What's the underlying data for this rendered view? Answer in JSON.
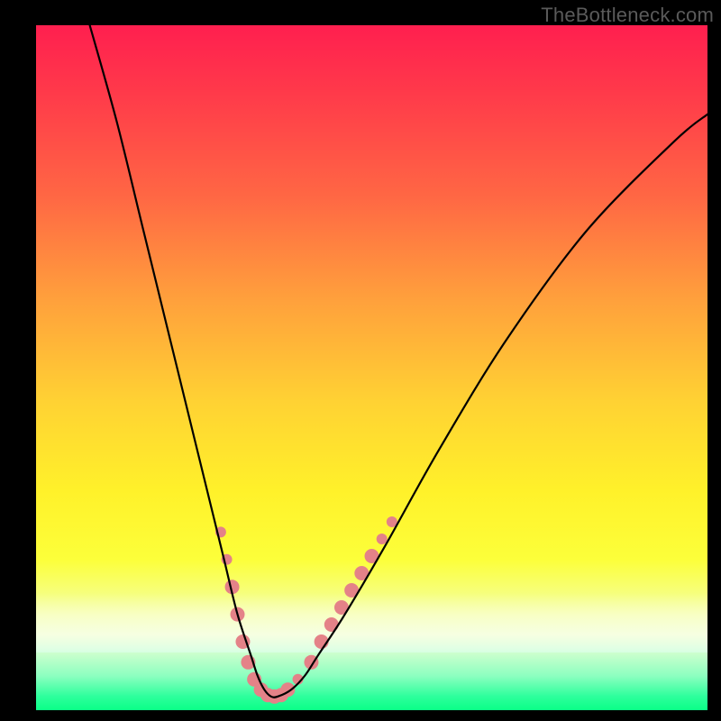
{
  "watermark": "TheBottleneck.com",
  "chart_data": {
    "type": "line",
    "title": "",
    "xlabel": "",
    "ylabel": "",
    "xlim": [
      0,
      100
    ],
    "ylim": [
      0,
      100
    ],
    "series": [
      {
        "name": "bottleneck-curve",
        "color": "#000000",
        "x": [
          8,
          12,
          16,
          20,
          24,
          26,
          28,
          30,
          32,
          33,
          34,
          35,
          36,
          38,
          40,
          42,
          46,
          52,
          60,
          70,
          82,
          95,
          100
        ],
        "y": [
          100,
          86,
          70,
          54,
          38,
          30,
          22,
          14,
          8,
          5,
          3,
          2,
          2,
          3,
          5,
          8,
          14,
          24,
          38,
          54,
          70,
          83,
          87
        ]
      }
    ],
    "markers": {
      "name": "highlight-points",
      "color": "#e48288",
      "radius_small": 5,
      "radius_large": 9,
      "points": [
        {
          "x": 27.5,
          "y": 26,
          "r": 6
        },
        {
          "x": 28.4,
          "y": 22,
          "r": 6
        },
        {
          "x": 29.2,
          "y": 18,
          "r": 8
        },
        {
          "x": 30.0,
          "y": 14,
          "r": 8
        },
        {
          "x": 30.8,
          "y": 10,
          "r": 8
        },
        {
          "x": 31.6,
          "y": 7,
          "r": 8
        },
        {
          "x": 32.5,
          "y": 4.5,
          "r": 8
        },
        {
          "x": 33.5,
          "y": 3,
          "r": 8
        },
        {
          "x": 34.5,
          "y": 2.2,
          "r": 8
        },
        {
          "x": 35.5,
          "y": 2,
          "r": 8
        },
        {
          "x": 36.5,
          "y": 2.2,
          "r": 8
        },
        {
          "x": 37.5,
          "y": 3,
          "r": 8
        },
        {
          "x": 39.0,
          "y": 4.5,
          "r": 6
        },
        {
          "x": 41.0,
          "y": 7,
          "r": 8
        },
        {
          "x": 42.5,
          "y": 10,
          "r": 8
        },
        {
          "x": 44.0,
          "y": 12.5,
          "r": 8
        },
        {
          "x": 45.5,
          "y": 15,
          "r": 8
        },
        {
          "x": 47.0,
          "y": 17.5,
          "r": 8
        },
        {
          "x": 48.5,
          "y": 20,
          "r": 8
        },
        {
          "x": 50.0,
          "y": 22.5,
          "r": 8
        },
        {
          "x": 51.5,
          "y": 25,
          "r": 6
        },
        {
          "x": 53.0,
          "y": 27.5,
          "r": 6
        }
      ]
    },
    "annotations": []
  }
}
